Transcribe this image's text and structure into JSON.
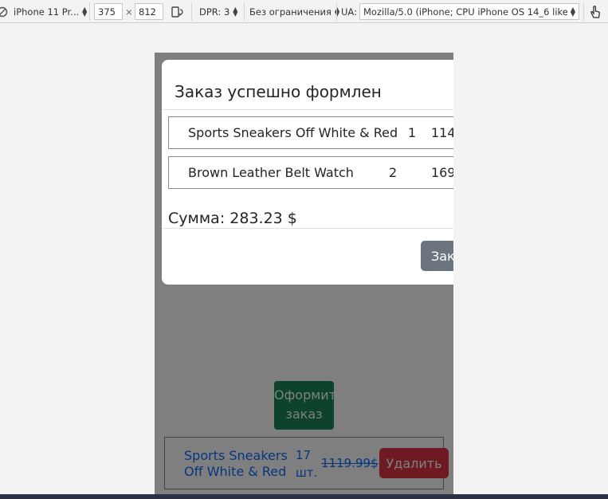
{
  "devtools": {
    "device": "iPhone 11 Pr...",
    "width": "375",
    "times": "×",
    "height": "812",
    "dpr": "DPR: 3",
    "throttle": "Без ограничения",
    "ua_label": "UA:",
    "ua_value": "Mozilla/5.0 (iPhone; CPU iPhone OS 14_6 like"
  },
  "page": {
    "checkout_button": "Оформить заказ",
    "cart_item": {
      "name": "Sports Sneakers Off White & Red",
      "qty": "17 шт.",
      "price": "1119.99$"
    },
    "delete_button": "Удалить"
  },
  "modal": {
    "title": "Заказ успешно формлен",
    "items": [
      {
        "name": "Sports Sneakers Off White & Red",
        "qty": "1",
        "price": "114"
      },
      {
        "name": "Brown Leather Belt Watch",
        "qty": "2",
        "price": "169"
      }
    ],
    "total": "Сумма: 283.23 $",
    "close_button": "Закрыть"
  },
  "colors": {
    "success": "#198754",
    "danger": "#dc3545",
    "secondary": "#6c757d",
    "link": "#0d6efd"
  }
}
